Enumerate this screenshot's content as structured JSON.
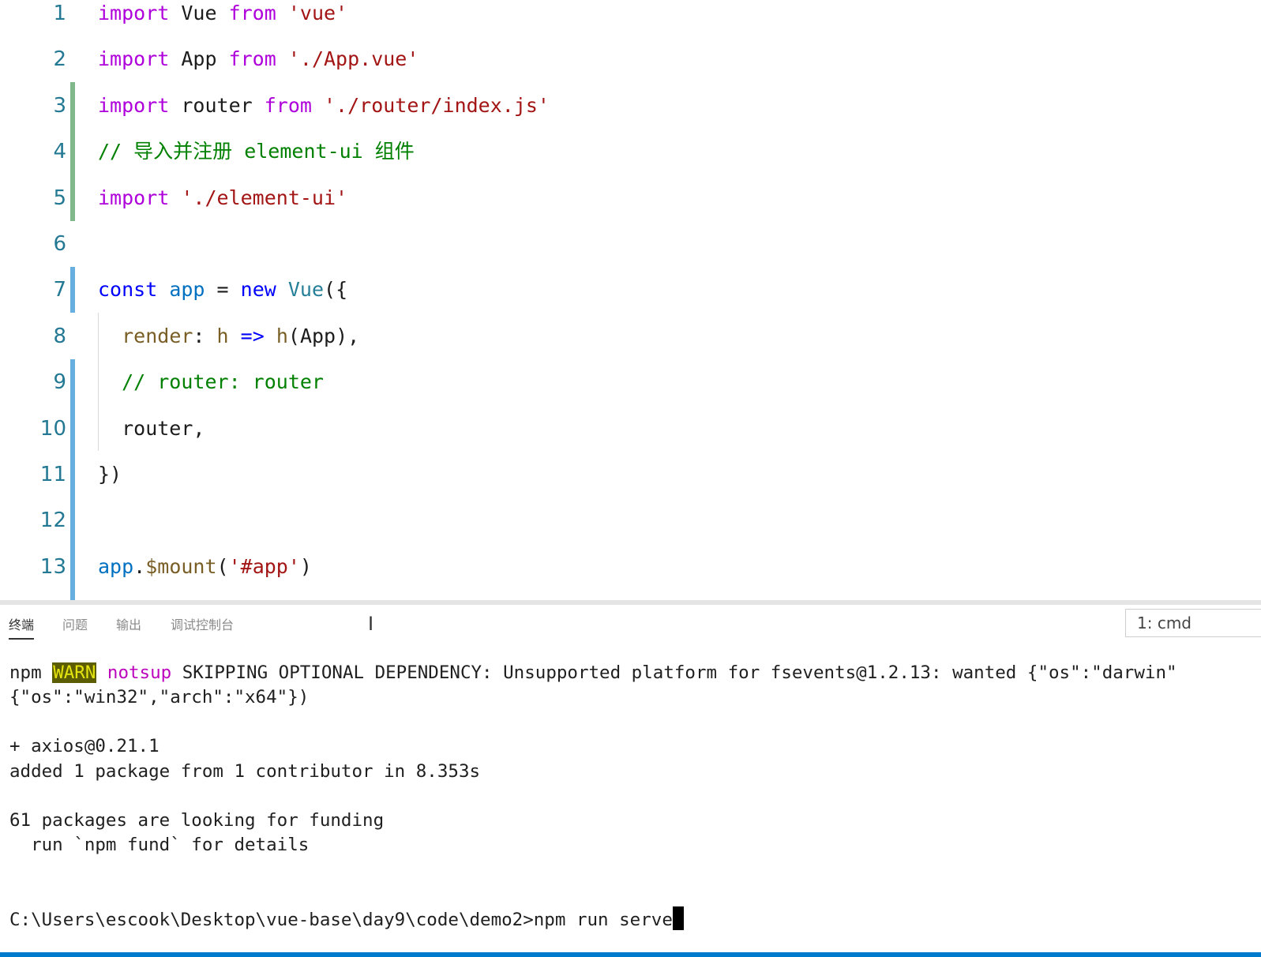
{
  "editor": {
    "lines": [
      {
        "num": "1",
        "tokens": [
          {
            "t": "import",
            "c": "kw"
          },
          {
            "t": " Vue ",
            "c": "plain"
          },
          {
            "t": "from",
            "c": "kw"
          },
          {
            "t": " 'vue'",
            "c": "str"
          }
        ]
      },
      {
        "num": "2",
        "tokens": [
          {
            "t": "import",
            "c": "kw"
          },
          {
            "t": " App ",
            "c": "plain"
          },
          {
            "t": "from",
            "c": "kw"
          },
          {
            "t": " './App.vue'",
            "c": "str"
          }
        ]
      },
      {
        "num": "3",
        "tokens": [
          {
            "t": "import",
            "c": "kw"
          },
          {
            "t": " router ",
            "c": "plain"
          },
          {
            "t": "from",
            "c": "kw"
          },
          {
            "t": " './router/index.js'",
            "c": "str"
          }
        ]
      },
      {
        "num": "4",
        "tokens": [
          {
            "t": "// 导入并注册 element-ui 组件",
            "c": "cm"
          }
        ]
      },
      {
        "num": "5",
        "tokens": [
          {
            "t": "import",
            "c": "kw"
          },
          {
            "t": " './element-ui'",
            "c": "str"
          }
        ]
      },
      {
        "num": "6",
        "tokens": []
      },
      {
        "num": "7",
        "tokens": [
          {
            "t": "const",
            "c": "kw2"
          },
          {
            "t": " ",
            "c": "plain"
          },
          {
            "t": "app",
            "c": "var"
          },
          {
            "t": " = ",
            "c": "plain"
          },
          {
            "t": "new",
            "c": "kw2"
          },
          {
            "t": " ",
            "c": "plain"
          },
          {
            "t": "Vue",
            "c": "type"
          },
          {
            "t": "({",
            "c": "plain"
          }
        ]
      },
      {
        "num": "8",
        "tokens": [
          {
            "t": "  ",
            "c": "plain"
          },
          {
            "t": "render",
            "c": "fn"
          },
          {
            "t": ": ",
            "c": "plain"
          },
          {
            "t": "h",
            "c": "fn"
          },
          {
            "t": " ",
            "c": "plain"
          },
          {
            "t": "=>",
            "c": "kw2"
          },
          {
            "t": " ",
            "c": "plain"
          },
          {
            "t": "h",
            "c": "fn"
          },
          {
            "t": "(App),",
            "c": "plain"
          }
        ]
      },
      {
        "num": "9",
        "tokens": [
          {
            "t": "  // router: router",
            "c": "cm"
          }
        ]
      },
      {
        "num": "10",
        "tokens": [
          {
            "t": "  router,",
            "c": "plain"
          }
        ]
      },
      {
        "num": "11",
        "tokens": [
          {
            "t": "})",
            "c": "plain"
          }
        ]
      },
      {
        "num": "12",
        "tokens": []
      },
      {
        "num": "13",
        "tokens": [
          {
            "t": "app",
            "c": "var"
          },
          {
            "t": ".",
            "c": "plain"
          },
          {
            "t": "$mount",
            "c": "fn"
          },
          {
            "t": "(",
            "c": "plain"
          },
          {
            "t": "'#app'",
            "c": "str"
          },
          {
            "t": ")",
            "c": "plain"
          }
        ]
      }
    ]
  },
  "panel": {
    "tabs": [
      "终端",
      "问题",
      "输出",
      "调试控制台"
    ],
    "active_tab": "终端",
    "terminal_select": "1: cmd"
  },
  "terminal": {
    "warn_prefix": "npm ",
    "warn_badge": "WARN",
    "warn_tag": "notsup",
    "warn_message": " SKIPPING OPTIONAL DEPENDENCY: Unsupported platform for fsevents@1.2.13: wanted {\"os\":\"darwin\"",
    "warn_continued": "{\"os\":\"win32\",\"arch\":\"x64\"})",
    "added_pkg": "+ axios@0.21.1",
    "added_summary": "added 1 package from 1 contributor in 8.353s",
    "funding_line": "61 packages are looking for funding",
    "fund_hint": "  run `npm fund` for details",
    "prompt": "C:\\Users\\escook\\Desktop\\vue-base\\day9\\code\\demo2>npm run serve"
  },
  "colors": {
    "keyword": "#af00db",
    "string": "#a31515",
    "comment": "#008000",
    "git_added": "#81b88b",
    "git_modified": "#66afe0",
    "status_bar": "#007acc"
  }
}
